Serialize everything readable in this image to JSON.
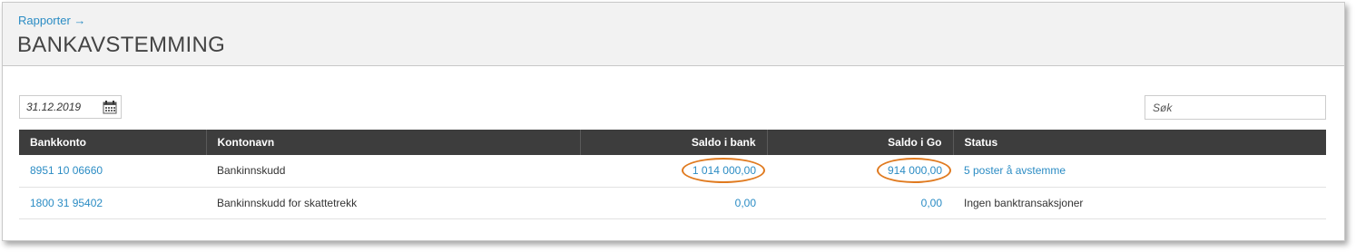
{
  "header": {
    "breadcrumb": "Rapporter →",
    "title": "BANKAVSTEMMING"
  },
  "filters": {
    "date_value": "31.12.2019",
    "calendar_icon": "calendar-icon",
    "search_placeholder": "Søk"
  },
  "table": {
    "columns": [
      "Bankkonto",
      "Kontonavn",
      "Saldo i bank",
      "Saldo i Go",
      "Status"
    ],
    "rows": [
      {
        "bankkonto": "8951 10 06660",
        "kontonavn": "Bankinnskudd",
        "saldo_bank": "1 014 000,00",
        "saldo_go": "914 000,00",
        "status": "5 poster å avstemme",
        "status_is_link": true,
        "highlighted": true
      },
      {
        "bankkonto": "1800 31 95402",
        "kontonavn": "Bankinnskudd for skattetrekk",
        "saldo_bank": "0,00",
        "saldo_go": "0,00",
        "status": "Ingen banktransaksjoner",
        "status_is_link": false,
        "highlighted": false
      }
    ]
  },
  "colors": {
    "link": "#2b8cc4",
    "header_bg": "#3d3d3d",
    "highlight_ring": "#e07a1f"
  }
}
